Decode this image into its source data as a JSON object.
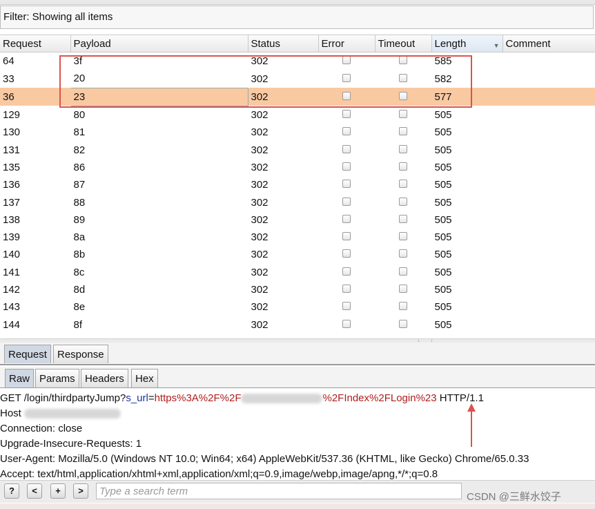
{
  "filter": {
    "text": "Filter: Showing all items"
  },
  "table": {
    "columns": [
      "Request",
      "Payload",
      "Status",
      "Error",
      "Timeout",
      "Length",
      "Comment"
    ],
    "rows": [
      {
        "request": "64",
        "payload": "3f",
        "status": "302",
        "length": "585"
      },
      {
        "request": "33",
        "payload": "20",
        "status": "302",
        "length": "582"
      },
      {
        "request": "36",
        "payload": "23",
        "status": "302",
        "length": "577"
      },
      {
        "request": "129",
        "payload": "80",
        "status": "302",
        "length": "505"
      },
      {
        "request": "130",
        "payload": "81",
        "status": "302",
        "length": "505"
      },
      {
        "request": "131",
        "payload": "82",
        "status": "302",
        "length": "505"
      },
      {
        "request": "135",
        "payload": "86",
        "status": "302",
        "length": "505"
      },
      {
        "request": "136",
        "payload": "87",
        "status": "302",
        "length": "505"
      },
      {
        "request": "137",
        "payload": "88",
        "status": "302",
        "length": "505"
      },
      {
        "request": "138",
        "payload": "89",
        "status": "302",
        "length": "505"
      },
      {
        "request": "139",
        "payload": "8a",
        "status": "302",
        "length": "505"
      },
      {
        "request": "140",
        "payload": "8b",
        "status": "302",
        "length": "505"
      },
      {
        "request": "141",
        "payload": "8c",
        "status": "302",
        "length": "505"
      },
      {
        "request": "142",
        "payload": "8d",
        "status": "302",
        "length": "505"
      },
      {
        "request": "143",
        "payload": "8e",
        "status": "302",
        "length": "505"
      },
      {
        "request": "144",
        "payload": "8f",
        "status": "302",
        "length": "505"
      }
    ],
    "selected_row_color": "#f9c9a2",
    "highlight_box_color": "#d9534f"
  },
  "tabs_primary": [
    "Request",
    "Response"
  ],
  "tabs_secondary": [
    "Raw",
    "Params",
    "Headers",
    "Hex"
  ],
  "request_text": {
    "line1_method_path": "GET /login/thirdpartyJump?",
    "line1_param_name": "s_url",
    "line1_eq": "=",
    "line1_value_start": "https%3A%2F%2F",
    "line1_value_end": "%2FIndex%2FLogin%23",
    "line1_protocol": " HTTP/1.1",
    "line2": "Host",
    "line3": "Connection: close",
    "line4": "Upgrade-Insecure-Requests: 1",
    "line5": "User-Agent: Mozilla/5.0 (Windows NT 10.0; Win64; x64) AppleWebKit/537.36 (KHTML, like Gecko) Chrome/65.0.33",
    "line6": "Accept: text/html,application/xhtml+xml,application/xml;q=0.9,image/webp,image/apng,*/*;q=0.8"
  },
  "search": {
    "help_label": "?",
    "prev_label": "<",
    "add_label": "+",
    "next_label": ">",
    "placeholder": "Type a search term"
  },
  "watermark": "CSDN @三鲜水饺子"
}
